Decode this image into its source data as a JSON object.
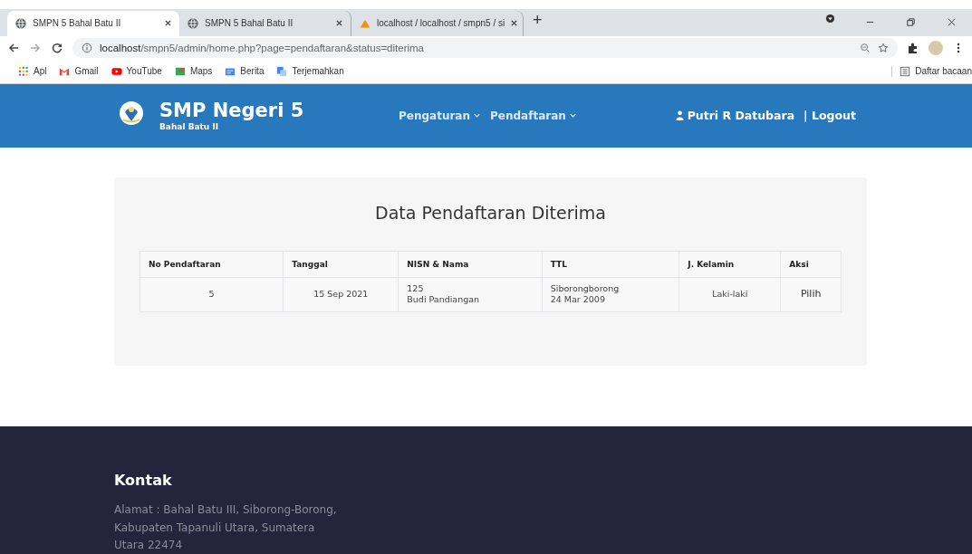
{
  "browser": {
    "tabs": [
      {
        "title": "SMPN 5 Bahal Batu II",
        "kind": "globe",
        "selected": true
      },
      {
        "title": "SMPN 5 Bahal Batu II",
        "kind": "globe",
        "selected": false
      },
      {
        "title": "localhost / localhost / smpn5 / si",
        "kind": "pma",
        "selected": false
      }
    ],
    "new_tab": "+",
    "url_host": "localhost",
    "url_path": "/smpn5/admin/home.php?page=pendaftaran&status=diterima",
    "bookmarks": [
      {
        "label": "Apl",
        "kind": "apps"
      },
      {
        "label": "Gmail",
        "kind": "gmail"
      },
      {
        "label": "YouTube",
        "kind": "youtube"
      },
      {
        "label": "Maps",
        "kind": "maps"
      },
      {
        "label": "Berita",
        "kind": "news"
      },
      {
        "label": "Terjemahkan",
        "kind": "translate"
      }
    ],
    "reading_list": "Daftar bacaan"
  },
  "navbar": {
    "brand": "SMP Negeri 5",
    "subtitle": "Bahal Batu II",
    "menus": [
      "Pengaturan",
      "Pendaftaran"
    ],
    "user": "Putri R Datubara",
    "logout": "| Logout"
  },
  "card": {
    "title": "Data Pendaftaran Diterima",
    "table": {
      "columns": [
        "No Pendaftaran",
        "Tanggal",
        "NISN & Nama",
        "TTL",
        "J. Kelamin",
        "Aksi"
      ],
      "rows": [
        {
          "no": "5",
          "tanggal": "15 Sep 2021",
          "nisn": "125",
          "nama": "Budi Pandiangan",
          "tempat": "Siborongborong",
          "tgl_lahir": "24 Mar 2009",
          "kelamin": "Laki-laki",
          "aksi": "Pilih"
        }
      ]
    }
  },
  "footer": {
    "heading": "Kontak",
    "address": "Alamat : Bahal Batu III, Siborong-Borong, Kabupaten Tapanuli Utara, Sumatera Utara 22474"
  }
}
